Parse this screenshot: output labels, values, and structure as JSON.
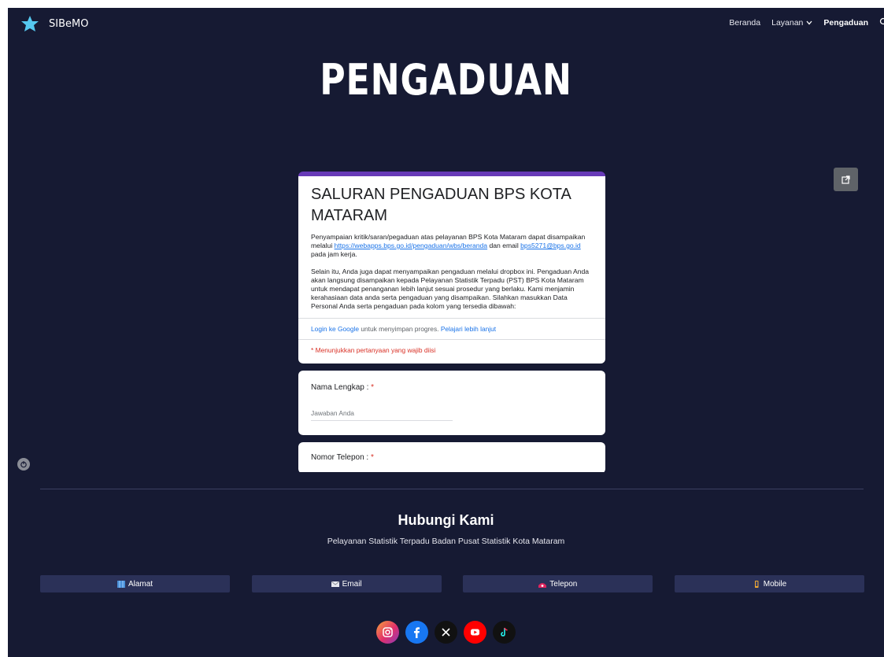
{
  "nav": {
    "brand": "SIBeMO",
    "items": [
      {
        "label": "Beranda"
      },
      {
        "label": "Layanan"
      },
      {
        "label": "Pengaduan"
      }
    ]
  },
  "hero": {
    "title": "PENGADUAN"
  },
  "form": {
    "title": "SALURAN PENGADUAN BPS KOTA MATARAM",
    "desc": {
      "p1_a": "Penyampaian kritik/saran/pegaduan atas pelayanan BPS Kota Mataram dapat disampaikan melalui ",
      "p1_link": "https://webapps.bps.go.id/pengaduan/wbs/beranda",
      "p1_b": " dan email ",
      "p1_email": "bps5271@bps.go.id",
      "p1_c": "  pada jam kerja.",
      "p2": "Selain itu, Anda juga dapat menyampaikan pengaduan melalui dropbox ini. Pengaduan Anda akan langsung disampaikan kepada Pelayanan Statistik Terpadu (PST) BPS Kota Mataram untuk mendapat penanganan lebih lanjut sesuai prosedur yang berlaku. Kami menjamin kerahasiaan data anda serta pengaduan yang disampaikan. Silahkan masukkan Data Personal Anda serta pengaduan pada kolom yang tersedia dibawah:"
    },
    "login_link": "Login ke Google",
    "login_text": " untuk menyimpan progres. ",
    "learn_more": "Pelajari lebih lanjut",
    "required_note": "* Menunjukkan pertanyaan yang wajib diisi",
    "questions": [
      {
        "label": "Nama Lengkap : ",
        "required_mark": "*",
        "placeholder": "Jawaban Anda"
      },
      {
        "label": "Nomor Telepon : ",
        "required_mark": "*"
      }
    ]
  },
  "contact": {
    "title": "Hubungi Kami",
    "subtitle": "Pelayanan Statistik Terpadu Badan Pusat Statistik Kota Mataram",
    "buttons": [
      {
        "label": "Alamat",
        "icon": "map-icon"
      },
      {
        "label": "Email",
        "icon": "envelope-icon"
      },
      {
        "label": "Telepon",
        "icon": "phone-icon"
      },
      {
        "label": "Mobile",
        "icon": "mobile-icon"
      }
    ]
  },
  "socials": [
    {
      "icon": "instagram-icon",
      "color": "#e1306c"
    },
    {
      "icon": "facebook-icon",
      "color": "#1877f2"
    },
    {
      "icon": "x-icon",
      "color": "#111111"
    },
    {
      "icon": "youtube-icon",
      "color": "#ff0000"
    },
    {
      "icon": "tiktok-icon",
      "color": "#111111"
    }
  ],
  "colors": {
    "page_bg": "#161a33",
    "form_accent": "#673ab7",
    "contact_button_bg": "#2b3158",
    "link": "#1a73e8",
    "required": "#d93025"
  }
}
